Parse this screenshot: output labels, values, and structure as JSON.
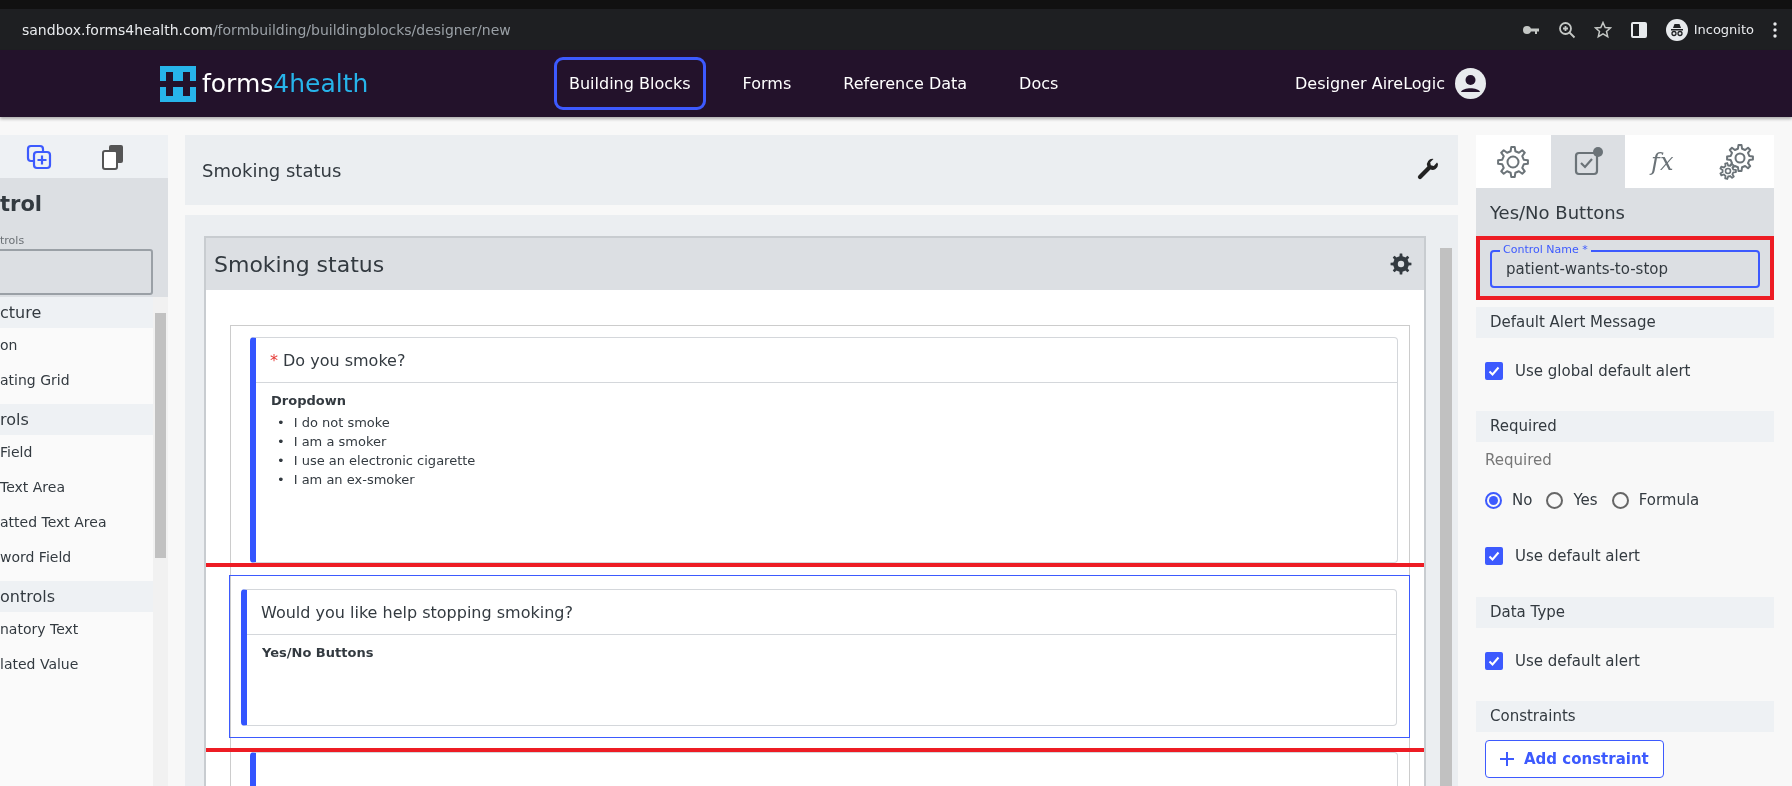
{
  "browser": {
    "url_host": "sandbox.forms4health.com",
    "url_path": "/formbuilding/buildingblocks/designer/new",
    "profile": "Incognito"
  },
  "navbar": {
    "logo": [
      "forms",
      "4health"
    ],
    "items": [
      {
        "label": "Building Blocks",
        "selected": true
      },
      {
        "label": "Forms",
        "selected": false
      },
      {
        "label": "Reference Data",
        "selected": false
      },
      {
        "label": "Docs",
        "selected": false
      }
    ],
    "user": "Designer AireLogic"
  },
  "left_panel": {
    "title": "trol",
    "search_label": "trols",
    "groups": [
      {
        "heading": "cture",
        "items": [
          "on",
          "ating Grid"
        ]
      },
      {
        "heading": "rols",
        "items": [
          "Field",
          "Text Area",
          "atted Text Area",
          "word Field"
        ]
      },
      {
        "heading": "ontrols",
        "items": [
          "natory Text",
          "lated Value"
        ]
      }
    ]
  },
  "center": {
    "title": "Smoking status",
    "section": {
      "title": "Smoking status",
      "questions": [
        {
          "label": "Do you smoke?",
          "required_mark": "*",
          "type": "Dropdown",
          "options": [
            {
              "bullet": "•",
              "label": "I do not smoke"
            },
            {
              "bullet": "•",
              "label": "I am a smoker"
            },
            {
              "bullet": "•",
              "label": "I use an electronic cigarette"
            },
            {
              "bullet": "•",
              "label": "I am an ex-smoker"
            }
          ],
          "selected": false
        },
        {
          "label": "Would you like help stopping smoking?",
          "type": "Yes/No Buttons",
          "selected": true
        }
      ]
    }
  },
  "right_panel": {
    "tabs": [
      {
        "kind": "gear",
        "selected": false
      },
      {
        "kind": "checkbox",
        "selected": true
      },
      {
        "kind": "text",
        "label": "fx",
        "selected": false
      },
      {
        "kind": "gears",
        "selected": false
      }
    ],
    "heading": "Yes/No Buttons",
    "control_name": {
      "label": "Control Name *",
      "value": "patient-wants-to-stop"
    },
    "sections": [
      {
        "heading": "Default Alert Message",
        "rows": [
          {
            "kind": "checkbox",
            "label": "Use global default alert",
            "checked": true
          }
        ]
      },
      {
        "heading": "Required",
        "rows": [
          {
            "kind": "caption",
            "label": "Required"
          },
          {
            "kind": "radios",
            "options": [
              {
                "label": "No",
                "selected": true
              },
              {
                "label": "Yes",
                "selected": false
              },
              {
                "label": "Formula",
                "selected": false
              }
            ]
          },
          {
            "kind": "checkbox",
            "label": "Use default alert",
            "checked": true
          }
        ]
      },
      {
        "heading": "Data Type",
        "rows": [
          {
            "kind": "checkbox",
            "label": "Use default alert",
            "checked": true
          }
        ]
      },
      {
        "heading": "Constraints",
        "rows": [
          {
            "kind": "button",
            "label": "Add constraint"
          }
        ]
      }
    ]
  }
}
